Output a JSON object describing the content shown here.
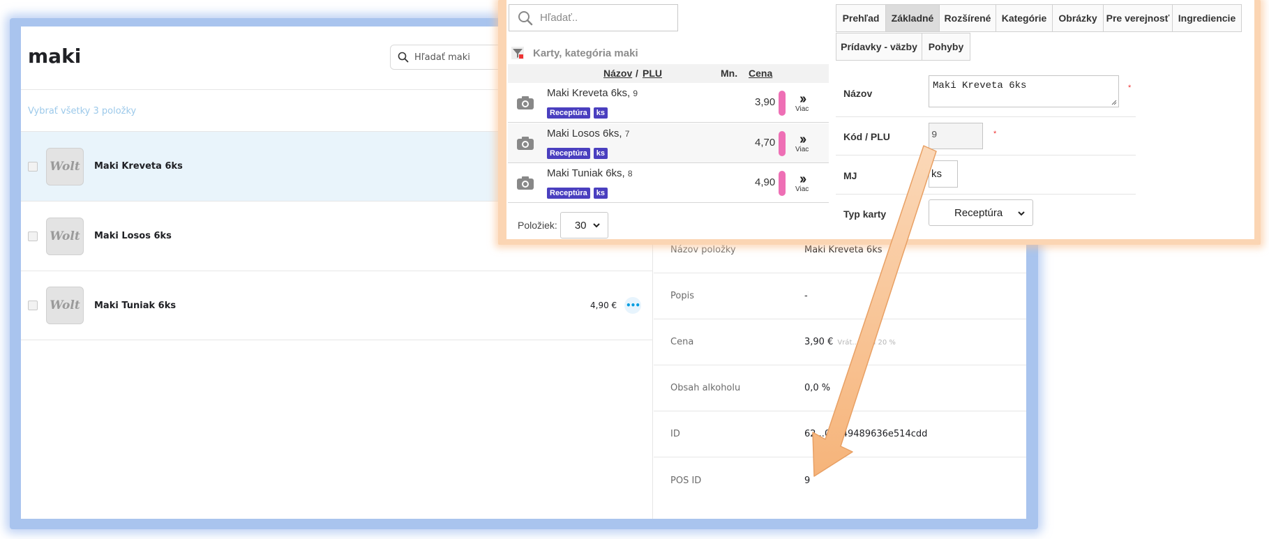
{
  "wolt": {
    "title": "maki",
    "search_placeholder": "Hľadať maki",
    "select_all": "Vybrať všetky 3 položky",
    "logo_text": "Wolt",
    "items": [
      {
        "name": "Maki Kreveta 6ks",
        "price": ""
      },
      {
        "name": "Maki Losos 6ks",
        "price": ""
      },
      {
        "name": "Maki Tuniak 6ks",
        "price": "4,90 €"
      }
    ],
    "more_label": "•••",
    "detail": [
      {
        "label": "Názov položky",
        "value": "Maki Kreveta 6ks",
        "sub": ""
      },
      {
        "label": "Popis",
        "value": "-",
        "sub": ""
      },
      {
        "label": "Cena",
        "value": "3,90 €",
        "sub": "Vrát... DPH 20 %"
      },
      {
        "label": "Obsah alkoholu",
        "value": "0,0 %",
        "sub": ""
      },
      {
        "label": "ID",
        "value": "62...0b749489636e514cdd",
        "sub": ""
      },
      {
        "label": "POS ID",
        "value": "9",
        "sub": ""
      }
    ]
  },
  "pos": {
    "search_placeholder": "Hľadať..",
    "category": "Karty, kategória maki",
    "columns": {
      "name": "Názov",
      "sep": "/",
      "plu": "PLU",
      "qty": "Mn.",
      "price": "Cena"
    },
    "items": [
      {
        "name": "Maki Kreveta 6ks,",
        "plu": "9",
        "price": "3,90",
        "badge1": "Receptúra",
        "badge2": "ks",
        "more": "Viac"
      },
      {
        "name": "Maki Losos 6ks,",
        "plu": "7",
        "price": "4,70",
        "badge1": "Receptúra",
        "badge2": "ks",
        "more": "Viac"
      },
      {
        "name": "Maki Tuniak 6ks,",
        "plu": "8",
        "price": "4,90",
        "badge1": "Receptúra",
        "badge2": "ks",
        "more": "Viac"
      }
    ],
    "pager_label": "Položiek:",
    "pager_value": "30",
    "tabs": [
      "Prehľad",
      "Základné",
      "Rozšírené",
      "Kategórie",
      "Obrázky",
      "Pre verejnosť",
      "Ingrediencie",
      "Prídavky - väzby",
      "Pohyby"
    ],
    "active_tab": "Základné",
    "form": {
      "name_label": "Názov",
      "name_value": "Maki Kreveta 6ks",
      "plu_label": "Kód / PLU",
      "plu_value": "9",
      "mj_label": "MJ",
      "mj_value": "ks",
      "type_label": "Typ karty",
      "type_value": "Receptúra",
      "required_mark": "*"
    }
  },
  "colors": {
    "wolt_blue": "#009de0",
    "badge_purple": "#4a3fbf",
    "pink_marker": "#ee6fb5",
    "arrow_fill": "#f9c393"
  }
}
